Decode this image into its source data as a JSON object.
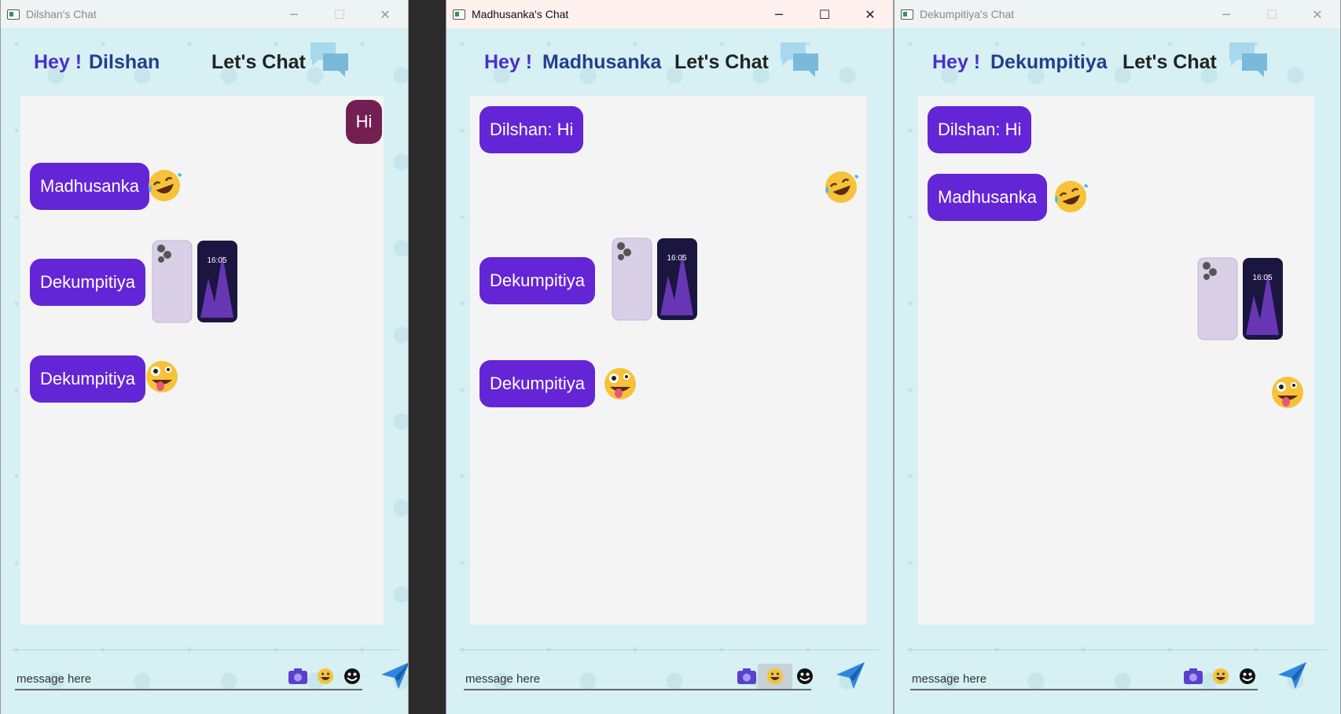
{
  "windows": [
    {
      "title": "Dilshan's Chat",
      "active": false,
      "greeting": "Hey !",
      "user": "Dilshan",
      "tagline": "Let's Chat",
      "input_placeholder": "message here",
      "messages": [
        {
          "text": "Hi",
          "mine": true
        },
        {
          "text": "Madhusanka",
          "emoji": "rofl-emoji"
        },
        {
          "text": "Dekumpitiya",
          "image": "phone-image"
        },
        {
          "text": "Dekumpitiya",
          "emoji": "zany-face-emoji"
        }
      ]
    },
    {
      "title": "Madhusanka's Chat",
      "active": true,
      "greeting": "Hey !",
      "user": "Madhusanka",
      "tagline": "Let's Chat",
      "input_placeholder": "message here",
      "messages": [
        {
          "text": "Dilshan: Hi"
        },
        {
          "emoji": "rofl-emoji",
          "mine": true
        },
        {
          "text": "Dekumpitiya",
          "image": "phone-image"
        },
        {
          "text": "Dekumpitiya",
          "emoji": "zany-face-emoji"
        }
      ]
    },
    {
      "title": "Dekumpitiya's Chat",
      "active": false,
      "greeting": "Hey !",
      "user": "Dekumpitiya",
      "tagline": "Let's Chat",
      "input_placeholder": "message here",
      "messages": [
        {
          "text": "Dilshan: Hi"
        },
        {
          "text": "Madhusanka",
          "emoji": "rofl-emoji"
        },
        {
          "image": "phone-image",
          "mine": true
        },
        {
          "emoji": "zany-face-emoji",
          "mine": true
        }
      ]
    }
  ],
  "phone_clock": "16:05",
  "colors": {
    "bubble": "#6425d6",
    "my_bubble": "#741f52",
    "hey": "#4a2fc9",
    "username": "#243e8c",
    "background": "#d6f0f3",
    "panel": "#f4f4f4"
  },
  "icons": [
    "camera-icon",
    "emoji-icon",
    "sticker-icon",
    "send-icon",
    "chat-bubbles-icon"
  ]
}
